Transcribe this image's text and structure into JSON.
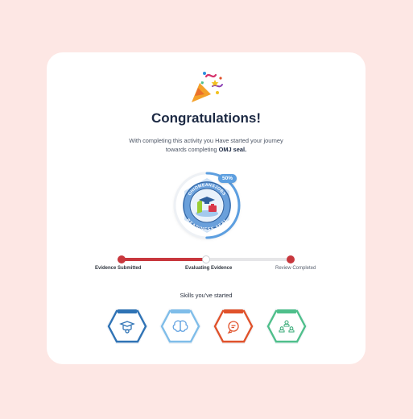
{
  "title": "Congratulations!",
  "message": {
    "line1": "With completing this activity you Have started your journey",
    "line2_prefix": "towards completing ",
    "line2_bold": "OMJ seal."
  },
  "seal": {
    "progress_label": "50%",
    "progress_value": 0.5,
    "ring_text_top": "OHIOMEANSJOBS",
    "ring_text_bottom": "READINESS SEAL"
  },
  "progress_steps": {
    "active_fraction": 0.5,
    "steps": [
      {
        "label": "Evidence Submitted",
        "state": "done"
      },
      {
        "label": "Evaluating Evidence",
        "state": "current"
      },
      {
        "label": "Review Completed",
        "state": "done"
      }
    ]
  },
  "skills": {
    "heading": "Skills you've started",
    "items": [
      {
        "icon": "graduate-icon",
        "color": "#2f73b5"
      },
      {
        "icon": "brain-icon",
        "color": "#7fbde9"
      },
      {
        "icon": "chat-bubble-icon",
        "color": "#e0522b"
      },
      {
        "icon": "team-icon",
        "color": "#4fbf8b"
      }
    ]
  },
  "colors": {
    "page_bg": "#fde7e4",
    "accent_red": "#c8373d",
    "accent_blue": "#5d9fe0"
  }
}
